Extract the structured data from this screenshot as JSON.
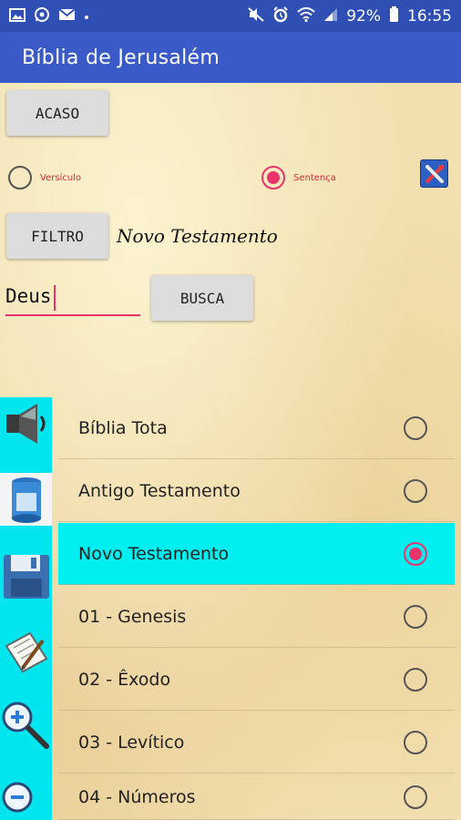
{
  "status_bar": {
    "time": "16:55",
    "battery": "92%",
    "left_icons": [
      "image-icon",
      "whatsapp-icon",
      "mail-icon",
      "dot-icon"
    ],
    "right_icons": [
      "mute-icon",
      "alarm-icon",
      "wifi-icon",
      "signal-icon",
      "battery-icon"
    ]
  },
  "app_bar": {
    "title": "Bíblia de Jerusalém"
  },
  "controls": {
    "random_button": "ACASO",
    "radio_verse_label": "Versículo",
    "radio_sentence_label": "Sentença",
    "selected_mode": "Sentença",
    "filter_button": "FILTRO",
    "filter_value": "Novo Testamento",
    "search_value": "Deus",
    "search_button": "BUSCA"
  },
  "sidebar_tools": [
    "speaker-icon",
    "paint-can-icon",
    "save-disk-icon",
    "edit-notes-icon",
    "zoom-in-icon",
    "zoom-out-icon"
  ],
  "list": {
    "items": [
      {
        "label": "Bíblia Tota",
        "selected": false
      },
      {
        "label": "Antigo Testamento",
        "selected": false
      },
      {
        "label": "Novo Testamento",
        "selected": true
      },
      {
        "label": "01 - Genesis",
        "selected": false
      },
      {
        "label": "02 - Êxodo",
        "selected": false
      },
      {
        "label": "03 - Levítico",
        "selected": false
      },
      {
        "label": "04 - Números",
        "selected": false
      }
    ]
  },
  "colors": {
    "status_bar": "#2f4fb5",
    "app_bar": "#3a5bc7",
    "accent": "#e8336b",
    "sidebar": "#00e5ee",
    "selected_row": "#00eff0"
  }
}
